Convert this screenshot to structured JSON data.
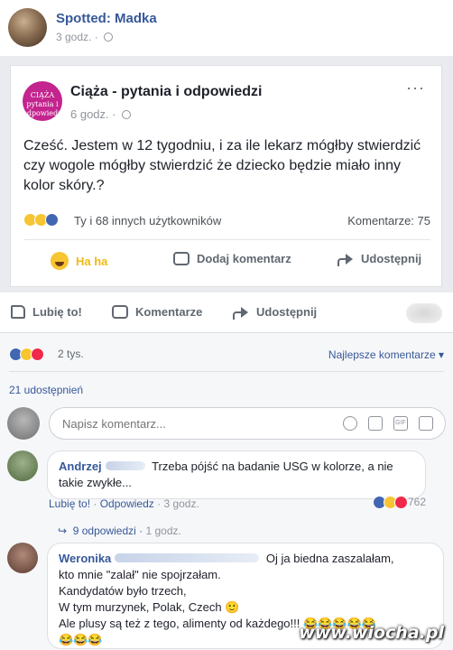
{
  "outer_post": {
    "author": "Spotted: Madka",
    "time": "3 godz.",
    "actions": {
      "like": "Lubię to!",
      "comment": "Komentarze",
      "share": "Udostępnij"
    }
  },
  "shared_post": {
    "logo_text": "CIĄŻA pytania i odpowiedzi",
    "page_name": "Ciąża - pytania i odpowiedzi",
    "time": "6 godz.",
    "more": "···",
    "text": "Cześć. Jestem w 12 tygodniu, i za ile lekarz mógłby stwierdzić czy wogole mógłby stwierdzić że dziecko będzie miało inny kolor skóry.?",
    "reactions_text": "Ty i 68 innych użytkowników",
    "comments_count": "Komentarze: 75",
    "actions": {
      "haha": "Ha ha",
      "comment": "Dodaj komentarz",
      "share": "Udostępnij"
    }
  },
  "stats": {
    "reactions_count": "2 tys.",
    "sort": "Najlepsze komentarze ▾",
    "shares": "21 udostępnień"
  },
  "composer": {
    "placeholder": "Napisz komentarz..."
  },
  "comments": [
    {
      "author": "Andrzej",
      "text": "Trzeba pójść na badanie USG w kolorze, a nie takie zwykłe...",
      "like": "Lubię to!",
      "reply": "Odpowiedz",
      "time": "3 godz.",
      "reactions": "762",
      "replies": "9 odpowiedzi",
      "replies_time": "1 godz."
    },
    {
      "author": "Weronika",
      "lines": [
        "Oj ja biedna zaszalałam,",
        "kto mnie \"zalał\" nie spojrzałam.",
        "Kandydatów było trzech,",
        "W tym murzynek, Polak, Czech 🙂",
        "Ale plusy są też z tego, alimenty od każdego!!! 😂😂😂😂😂",
        "😂😂😂"
      ]
    }
  ],
  "watermark": "www.wiocha.pl",
  "colors": {
    "link": "#365899",
    "haha": "#f7c531",
    "like": "#4267b2",
    "love": "#f0284a",
    "page_logo": "#c3248e"
  }
}
